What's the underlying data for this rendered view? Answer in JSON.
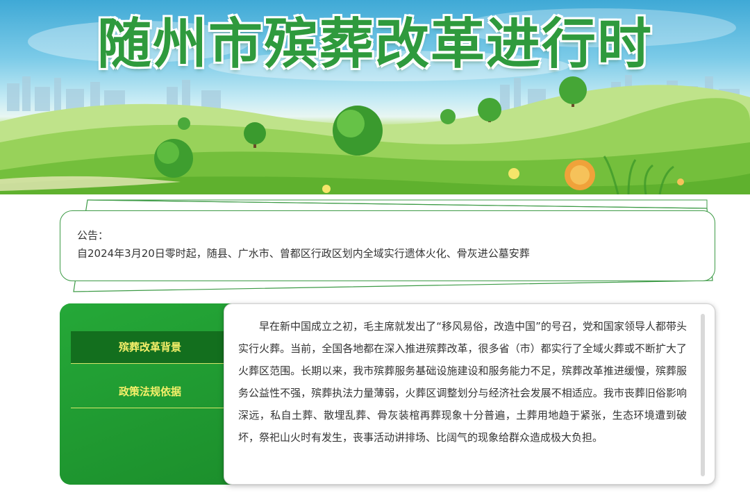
{
  "banner": {
    "title": "随州市殡葬改革进行时"
  },
  "notice": {
    "label": "公告：",
    "text": "自2024年3月20日零时起，随县、广水市、曾都区行政区划内全域实行遗体火化、骨灰进公墓安葬"
  },
  "sidebar": {
    "items": [
      {
        "label": "殡葬改革背景",
        "active": true
      },
      {
        "label": "政策法规依据",
        "active": false
      }
    ]
  },
  "content": {
    "paragraph": "早在新中国成立之初，毛主席就发出了“移风易俗，改造中国”的号召，党和国家领导人都带头实行火葬。当前，全国各地都在深入推进殡葬改革，很多省（市）都实行了全域火葬或不断扩大了火葬区范围。长期以来，我市殡葬服务基础设施建设和服务能力不足，殡葬改革推进缓慢，殡葬服务公益性不强，殡葬执法力量薄弱，火葬区调整划分与经济社会发展不相适应。我市丧葬旧俗影响深远，私自土葬、散埋乱葬、骨灰装棺再葬现象十分普遍，土葬用地趋于紧张，生态环境遭到破坏，祭祀山火时有发生，丧事活动讲排场、比阔气的现象给群众造成极大负担。"
  },
  "colors": {
    "brand_green": "#1f9a30",
    "menu_text": "#f7f06a",
    "active_item": "#136f1e",
    "frame_green": "#3c9a45"
  }
}
